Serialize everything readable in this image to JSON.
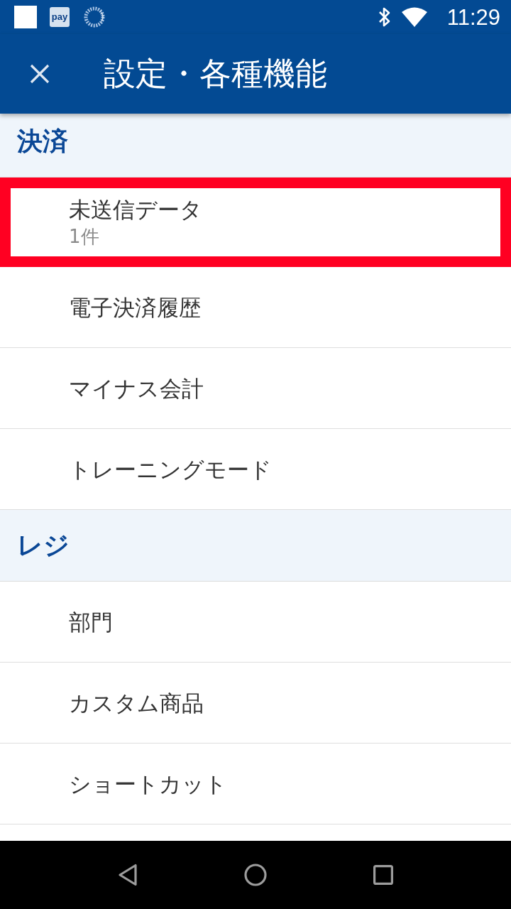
{
  "status_bar": {
    "app_label": "pay",
    "time": "11:29"
  },
  "header": {
    "title": "設定・各種機能"
  },
  "sections": [
    {
      "title": "決済",
      "items": [
        {
          "label": "未送信データ",
          "subtitle": "1件",
          "highlighted": true
        },
        {
          "label": "電子決済履歴",
          "highlighted": false
        },
        {
          "label": "マイナス会計",
          "highlighted": false
        },
        {
          "label": "トレーニングモード",
          "highlighted": false
        }
      ]
    },
    {
      "title": "レジ",
      "items": [
        {
          "label": "部門",
          "highlighted": false
        },
        {
          "label": "カスタム商品",
          "highlighted": false
        },
        {
          "label": "ショートカット",
          "highlighted": false
        }
      ]
    }
  ]
}
